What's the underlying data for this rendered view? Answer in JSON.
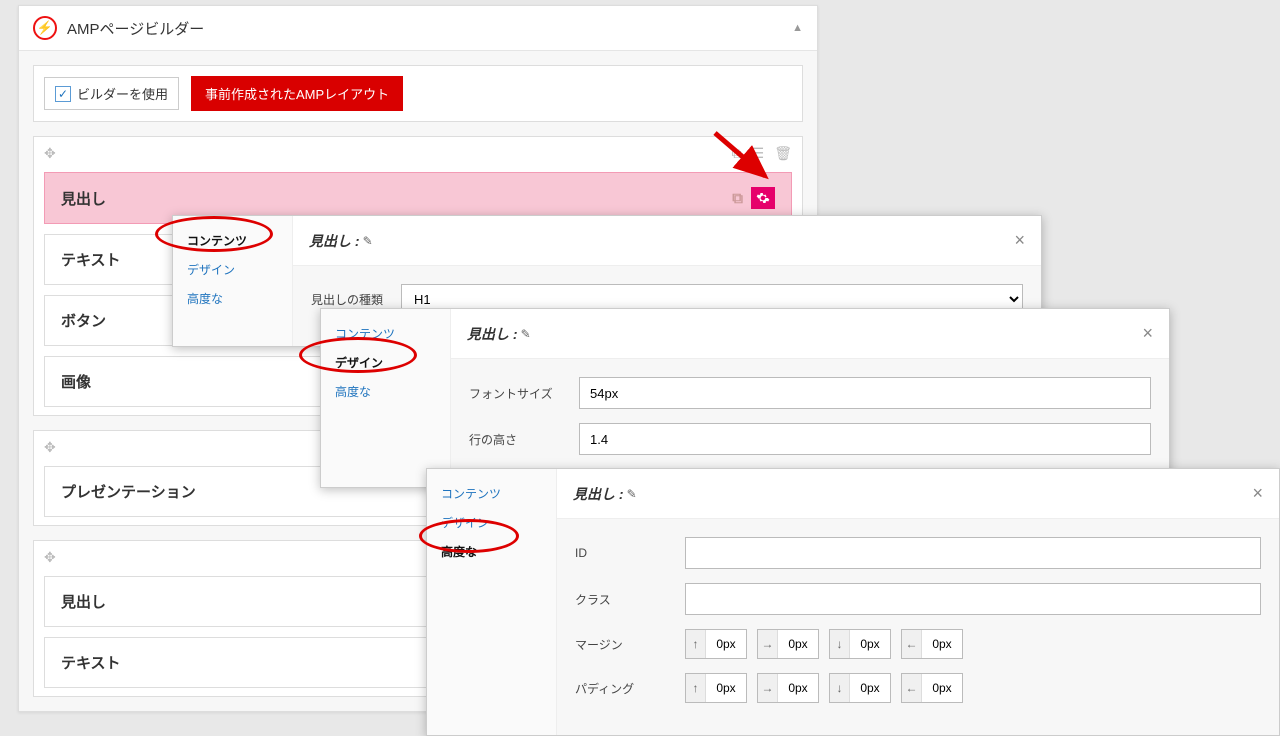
{
  "builder": {
    "title": "AMPページビルダー",
    "use_builder": "ビルダーを使用",
    "premade_btn": "事前作成されたAMPレイアウト"
  },
  "modules": {
    "heading": "見出し",
    "text": "テキスト",
    "button": "ボタン",
    "image": "画像",
    "presentation": "プレゼンテーション",
    "heading2": "見出し",
    "text2": "テキスト"
  },
  "nav": {
    "content": "コンテンツ",
    "design": "デザイン",
    "advanced": "高度な"
  },
  "dialog1": {
    "title": "見出し :",
    "heading_type_label": "見出しの種類",
    "heading_type_value": "H1"
  },
  "dialog2": {
    "title": "見出し :",
    "fontsize_label": "フォントサイズ",
    "fontsize_value": "54px",
    "lineheight_label": "行の高さ",
    "lineheight_value": "1.4"
  },
  "dialog3": {
    "title": "見出し :",
    "id_label": "ID",
    "id_value": "",
    "class_label": "クラス",
    "class_value": "",
    "margin_label": "マージン",
    "padding_label": "パディング",
    "sp": "0px"
  }
}
